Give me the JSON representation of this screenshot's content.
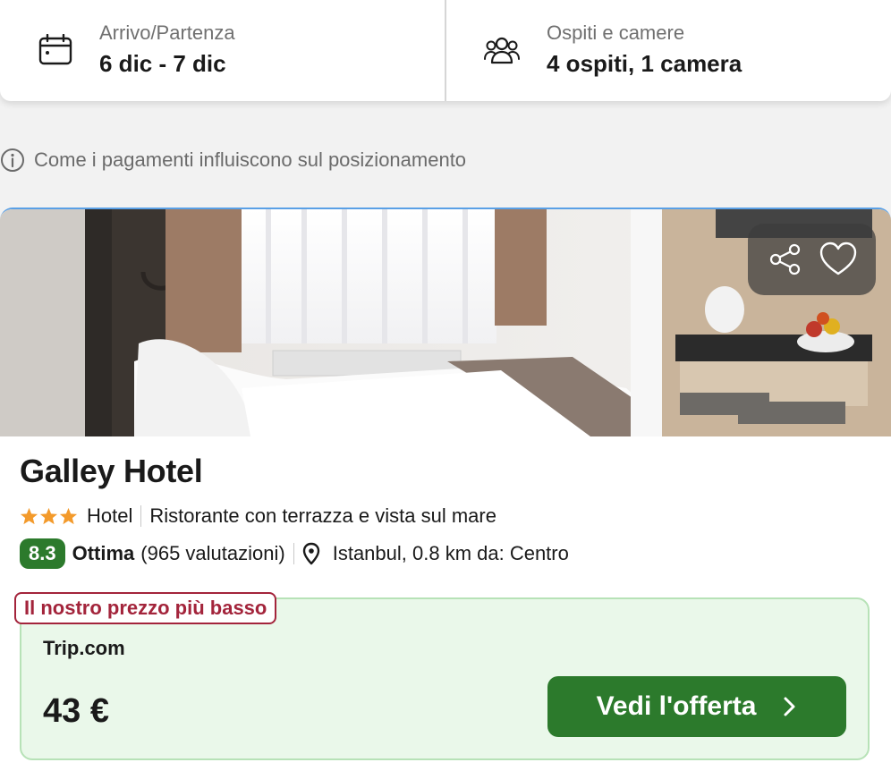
{
  "search": {
    "dates": {
      "label": "Arrivo/Partenza",
      "value": "6 dic - 7 dic",
      "icon": "calendar-icon"
    },
    "guests": {
      "label": "Ospiti e camere",
      "value": "4 ospiti, 1 camera",
      "icon": "guests-icon"
    }
  },
  "notice": {
    "text": "Come i pagamenti influiscono sul posizionamento",
    "icon": "info-icon"
  },
  "hotel": {
    "name": "Galley Hotel",
    "stars": 3,
    "type": "Hotel",
    "highlight": "Ristorante con terrazza e vista sul mare",
    "score": "8.3",
    "rating_word": "Ottima",
    "reviews": "(965 valutazioni)",
    "location": "Istanbul, 0.8 km da: Centro",
    "photo": {
      "dots": 4,
      "active_dot": 0
    }
  },
  "offer": {
    "badge": "Il nostro prezzo più basso",
    "provider": "Trip.com",
    "price": "43 €",
    "cta_label": "Vedi l'offerta"
  },
  "colors": {
    "brand_green": "#2c7a2c",
    "badge_red": "#a3243b",
    "offer_bg": "#eaf8ea",
    "star": "#f39a2b"
  }
}
